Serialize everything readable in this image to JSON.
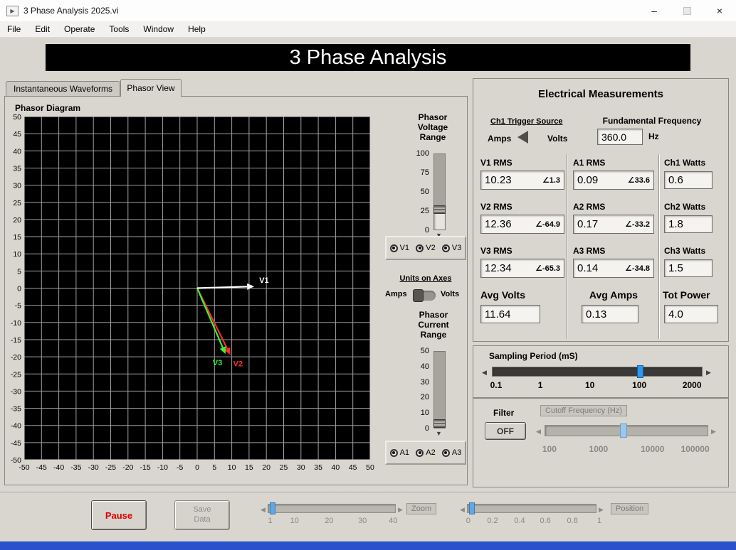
{
  "window": {
    "title": "3 Phase Analysis 2025.vi",
    "menus": [
      "File",
      "Edit",
      "Operate",
      "Tools",
      "Window",
      "Help"
    ],
    "controls": {
      "minimize": "–",
      "close": "×"
    }
  },
  "banner": {
    "title": "3 Phase Analysis"
  },
  "tabs": {
    "waveforms": "Instantaneous Waveforms",
    "phasor": "Phasor View"
  },
  "phasor_panel": {
    "title": "Phasor Diagram",
    "voltage_range": {
      "label": "Phasor Voltage Range",
      "ticks": [
        "100",
        "75",
        "50",
        "25",
        "0"
      ]
    },
    "voltage_channels": [
      "V1",
      "V2",
      "V3"
    ],
    "units_toggle": {
      "label": "Units on Axes",
      "left": "Amps",
      "right": "Volts"
    },
    "current_range": {
      "label": "Phasor Current Range",
      "ticks": [
        "50",
        "40",
        "30",
        "20",
        "10",
        "0"
      ]
    },
    "current_channels": [
      "A1",
      "A2",
      "A3"
    ]
  },
  "chart_data": {
    "type": "scatter",
    "subtype": "phasor-diagram",
    "title": "Phasor Diagram",
    "xlim": [
      -50,
      50
    ],
    "ylim": [
      -50,
      50
    ],
    "grid": true,
    "grid_step": 5,
    "x_ticks": [
      -50,
      -45,
      -40,
      -35,
      -30,
      -25,
      -20,
      -15,
      -10,
      -5,
      0,
      5,
      10,
      15,
      20,
      25,
      30,
      35,
      40,
      45,
      50
    ],
    "y_ticks": [
      50,
      45,
      40,
      35,
      30,
      25,
      20,
      15,
      10,
      5,
      0,
      -5,
      -10,
      -15,
      -20,
      -25,
      -30,
      -35,
      -40,
      -45,
      -50
    ],
    "series": [
      {
        "name": "V2",
        "color": "#ff2b2b",
        "origin": [
          0,
          0
        ],
        "end": [
          9.6,
          -19.5
        ],
        "label_dx": 4,
        "label_dy": 16
      },
      {
        "name": "V3",
        "color": "#37f437",
        "origin": [
          0,
          0
        ],
        "end": [
          8.2,
          -19.2
        ],
        "label_dx": -18,
        "label_dy": 16
      },
      {
        "name": "V1",
        "color": "#ffffff",
        "origin": [
          0,
          0
        ],
        "end": [
          16.5,
          0.5
        ],
        "label_dx": 7,
        "label_dy": -5
      }
    ]
  },
  "measurements": {
    "title": "Electrical Measurements",
    "angle_symbol": "∠",
    "trigger": {
      "label": "Ch1 Trigger Source",
      "left": "Amps",
      "right": "Volts"
    },
    "fundamental": {
      "label": "Fundamental Frequency",
      "value": "360.0",
      "unit": "Hz"
    },
    "voltages": [
      {
        "label": "V1 RMS",
        "value": "10.23",
        "angle": "1.3"
      },
      {
        "label": "V2 RMS",
        "value": "12.36",
        "angle": "-64.9"
      },
      {
        "label": "V3 RMS",
        "value": "12.34",
        "angle": "-65.3"
      }
    ],
    "currents": [
      {
        "label": "A1 RMS",
        "value": "0.09",
        "angle": "33.6"
      },
      {
        "label": "A2 RMS",
        "value": "0.17",
        "angle": "-33.2"
      },
      {
        "label": "A3 RMS",
        "value": "0.14",
        "angle": "-34.8"
      }
    ],
    "watts": [
      {
        "label": "Ch1 Watts",
        "value": "0.6"
      },
      {
        "label": "Ch2 Watts",
        "value": "1.8"
      },
      {
        "label": "Ch3 Watts",
        "value": "1.5"
      }
    ],
    "avg_volts": {
      "label": "Avg Volts",
      "value": "11.64"
    },
    "avg_amps": {
      "label": "Avg Amps",
      "value": "0.13"
    },
    "tot_power": {
      "label": "Tot Power",
      "value": "4.0"
    }
  },
  "sampling": {
    "label": "Sampling Period (mS)",
    "ticks": [
      "0.1",
      "1",
      "10",
      "100",
      "2000"
    ]
  },
  "filter": {
    "label": "Filter",
    "state": "OFF",
    "cutoff_label": "Cutoff Frequency (Hz)",
    "ticks": [
      "100",
      "1000",
      "10000",
      "100000"
    ]
  },
  "transport": {
    "pause": "Pause",
    "save": "Save Data",
    "zoom": {
      "label": "Zoom",
      "ticks": [
        "1",
        "10",
        "20",
        "30",
        "40"
      ]
    },
    "position": {
      "label": "Position",
      "ticks": [
        "0",
        "0.2",
        "0.4",
        "0.6",
        "0.8",
        "1"
      ]
    }
  }
}
